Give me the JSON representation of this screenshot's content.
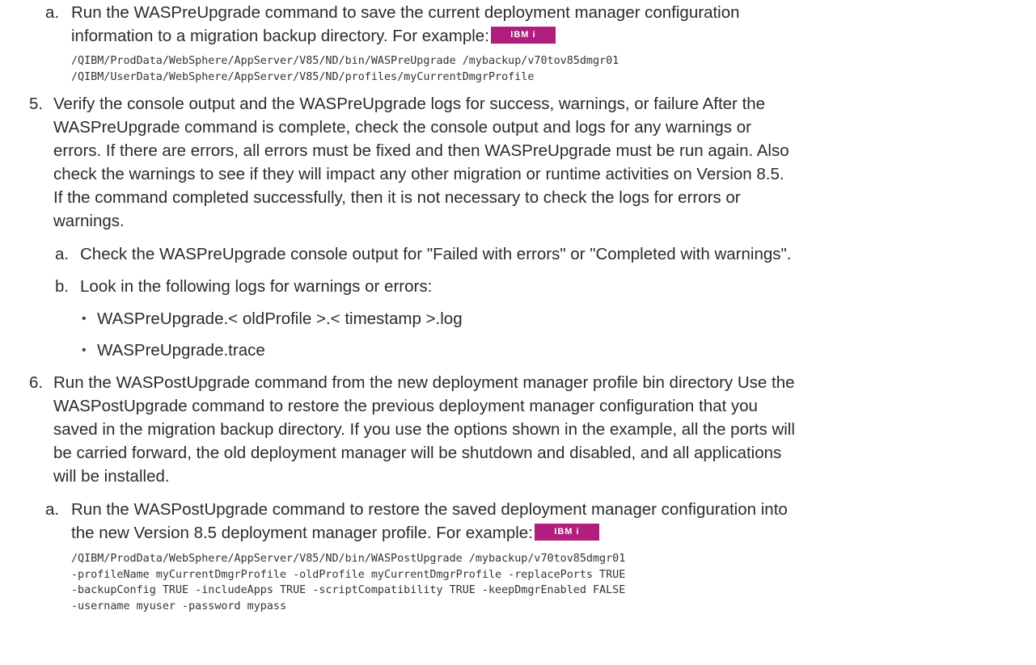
{
  "badge_label": "IBM i",
  "steps": {
    "s4a": {
      "marker": "a.",
      "lines": [
        "Run the WASPreUpgrade command to save the current deployment manager configuration",
        "information to a migration backup directory. For example:"
      ],
      "code": [
        "/QIBM/ProdData/WebSphere/AppServer/V85/ND/bin/WASPreUpgrade /mybackup/v70tov85dmgr01",
        "/QIBM/UserData/WebSphere/AppServer/V85/ND/profiles/myCurrentDmgrProfile"
      ]
    },
    "s5": {
      "marker": "5.",
      "lines": [
        "Verify the console output and the WASPreUpgrade logs for success, warnings, or failure After the",
        "WASPreUpgrade command is complete, check the console output and logs for any warnings or",
        "errors. If there are errors, all errors must be fixed and then WASPreUpgrade must be run again. Also",
        "check the warnings to see if they will impact any other migration or runtime activities on Version 8.5.",
        "If the command completed successfully, then it is not necessary to check the logs for errors or",
        "warnings."
      ]
    },
    "s5a": {
      "marker": "a.",
      "text": "Check the WASPreUpgrade console output for \"Failed with errors\" or \"Completed with warnings\"."
    },
    "s5b": {
      "marker": "b.",
      "text": "Look in the following logs for warnings or errors:",
      "bullets": [
        "WASPreUpgrade.< oldProfile >.< timestamp >.log",
        "WASPreUpgrade.trace"
      ]
    },
    "s6": {
      "marker": "6.",
      "lines": [
        "Run the WASPostUpgrade command from the new deployment manager profile bin directory Use the",
        "WASPostUpgrade command to restore the previous deployment manager configuration that you",
        "saved in the migration backup directory. If you use the options shown in the example, all the ports will",
        "be carried forward, the old deployment manager will be shutdown and disabled, and all applications",
        "will be installed."
      ]
    },
    "s6a": {
      "marker": "a.",
      "lines": [
        "Run the WASPostUpgrade command to restore the saved deployment manager configuration into",
        "the new Version 8.5 deployment manager profile. For example:"
      ],
      "code": [
        "/QIBM/ProdData/WebSphere/AppServer/V85/ND/bin/WASPostUpgrade /mybackup/v70tov85dmgr01",
        "-profileName myCurrentDmgrProfile -oldProfile myCurrentDmgrProfile -replacePorts TRUE",
        "-backupConfig TRUE -includeApps TRUE -scriptCompatibility TRUE -keepDmgrEnabled FALSE",
        "-username myuser -password mypass"
      ]
    }
  }
}
